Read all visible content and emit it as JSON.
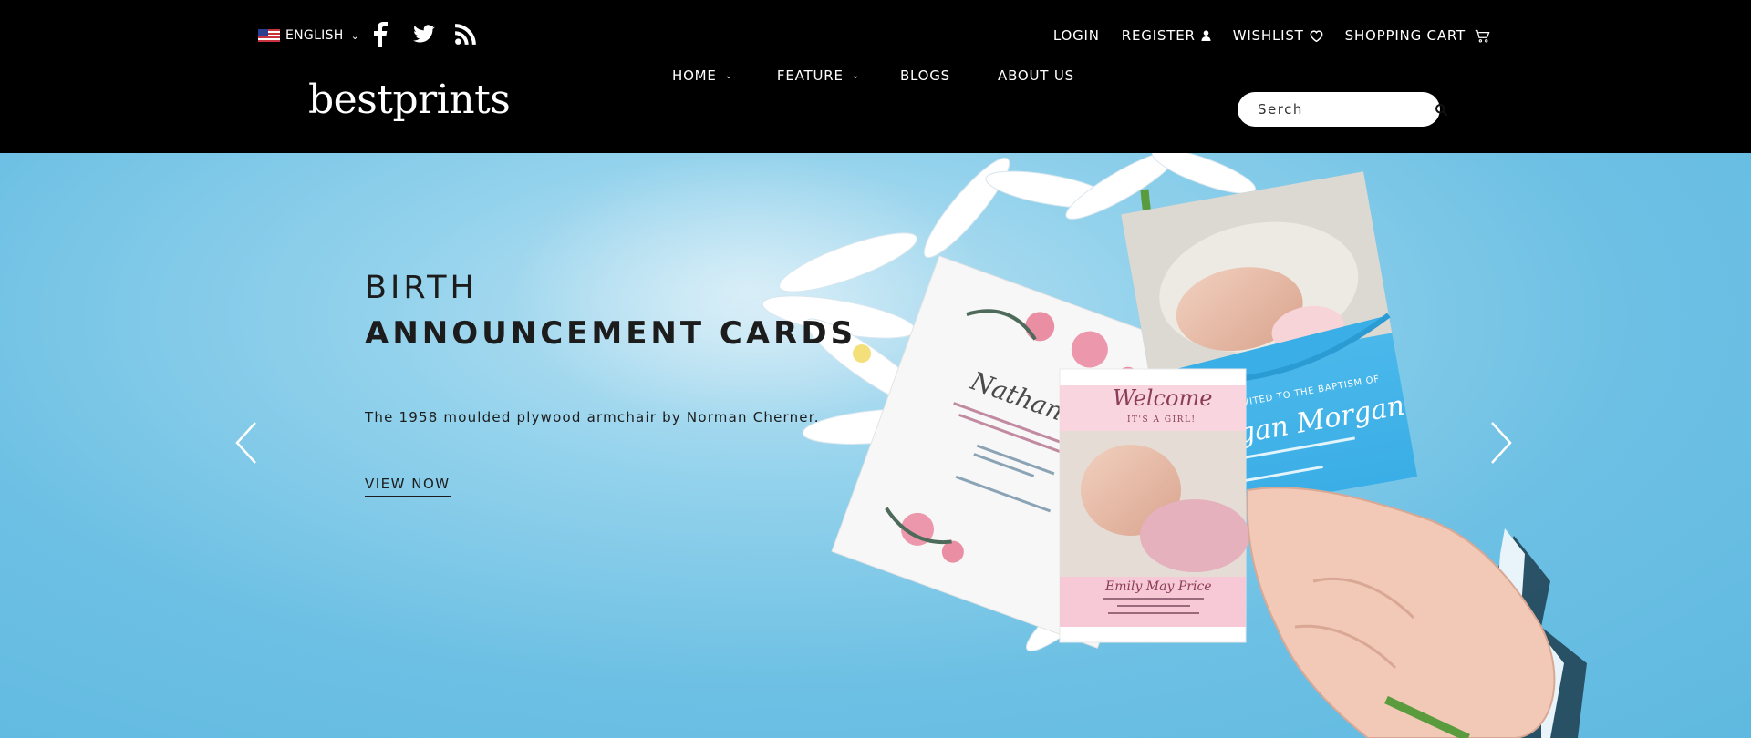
{
  "header": {
    "language": {
      "label": "ENGLISH"
    },
    "social": [
      "facebook-icon",
      "twitter-icon",
      "rss-icon"
    ],
    "top_nav": [
      {
        "label": "LOGIN"
      },
      {
        "label": "REGISTER"
      },
      {
        "label": "WISHLIST"
      },
      {
        "label": "SHOPPING CART"
      }
    ],
    "logo": "bestprints",
    "main_nav": [
      {
        "label": "HOME"
      },
      {
        "label": "FEATURE"
      },
      {
        "label": "BLOGS"
      },
      {
        "label": "ABOUT US"
      }
    ],
    "search": {
      "placeholder": "Serch"
    }
  },
  "hero": {
    "title_line_1": "BIRTH",
    "title_line_2": "ANNOUNCEMENT CARDS",
    "subtitle": "The 1958 moulded plywood armchair by Norman Cherner.",
    "cta": "VIEW NOW",
    "cards": {
      "wedding_names": "Nathan & Emily",
      "welcome_title": "Welcome",
      "welcome_sub": "IT'S A GIRL!",
      "baby_name": "Emily May Price",
      "baptism_invite": "YOU ARE INVITED TO THE BAPTISM OF",
      "baptism_name": "Negan Morgan"
    }
  },
  "colors": {
    "header_bg": "#000000",
    "hero_bg": "#6dc0e4",
    "text_dark": "#1c1c1c"
  }
}
